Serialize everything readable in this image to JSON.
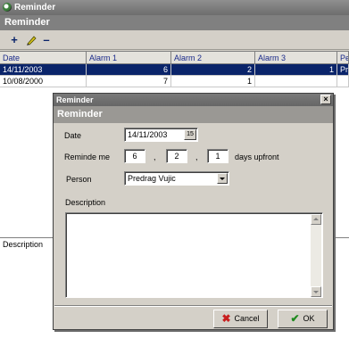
{
  "window": {
    "title": "Reminder",
    "header": "Reminder"
  },
  "toolbar": {
    "add_icon": "plus-icon",
    "edit_icon": "pencil-icon",
    "delete_icon": "minus-icon"
  },
  "grid": {
    "columns": [
      "Date",
      "Alarm 1",
      "Alarm 2",
      "Alarm 3",
      "Pe"
    ],
    "rows": [
      {
        "date": "14/11/2003",
        "alarm1": "6",
        "alarm2": "2",
        "alarm3": "1",
        "person": "Pre",
        "selected": true
      },
      {
        "date": "10/08/2000",
        "alarm1": "7",
        "alarm2": "1",
        "alarm3": "",
        "person": "",
        "selected": false
      }
    ]
  },
  "description_panel": {
    "label": "Description"
  },
  "dialog": {
    "title": "Reminder",
    "header": "Reminder",
    "date_label": "Date",
    "date_value": "14/11/2003",
    "calendar_icon": "15",
    "remind_label": "Reminde me",
    "remind_values": [
      "6",
      "2",
      "1"
    ],
    "separator": ",",
    "days_label": "days upfront",
    "person_label": "Person",
    "person_value": "Predrag Vujic",
    "description_label": "Description",
    "cancel_label": "Cancel",
    "ok_label": "OK"
  },
  "colors": {
    "selection": "#0a246a",
    "cancel_icon": "#c81e1e",
    "ok_icon": "#1f8a1f"
  }
}
